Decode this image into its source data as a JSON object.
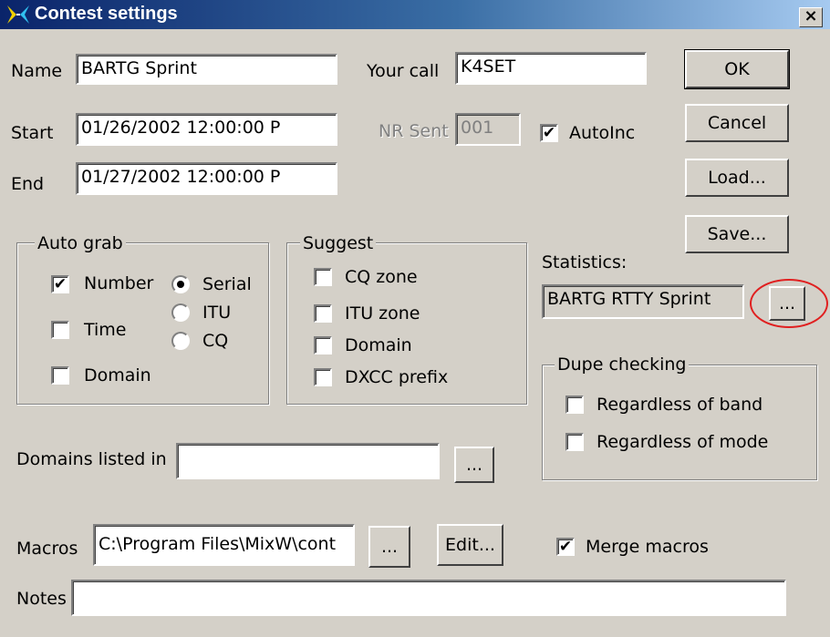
{
  "window": {
    "title": "Contest settings",
    "close_glyph": "×"
  },
  "fields": {
    "name_label": "Name",
    "name_value": "BARTG Sprint",
    "yourcall_label": "Your call",
    "yourcall_value": "K4SET",
    "start_label": "Start",
    "start_value": "01/26/2002 12:00:00 P",
    "nrsent_label": "NR Sent",
    "nrsent_value": "001",
    "end_label": "End",
    "end_value": "01/27/2002 12:00:00 P",
    "autoinc_label": "AutoInc",
    "autoinc_checked": true
  },
  "buttons": {
    "ok": "OK",
    "cancel": "Cancel",
    "load": "Load...",
    "save": "Save...",
    "stats_browse": "...",
    "domains_browse": "...",
    "macros_browse": "...",
    "edit": "Edit..."
  },
  "autograb": {
    "title": "Auto grab",
    "number": "Number",
    "number_checked": true,
    "time": "Time",
    "time_checked": false,
    "domain": "Domain",
    "domain_checked": false,
    "serial": "Serial",
    "itu": "ITU",
    "cq": "CQ",
    "selected": "Serial"
  },
  "suggest": {
    "title": "Suggest",
    "cq_zone": "CQ zone",
    "itu_zone": "ITU zone",
    "domain": "Domain",
    "dxcc": "DXCC prefix"
  },
  "statistics": {
    "label": "Statistics:",
    "value": "BARTG RTTY Sprint"
  },
  "dupe": {
    "title": "Dupe checking",
    "band": "Regardless of band",
    "mode": "Regardless of mode"
  },
  "domains": {
    "label": "Domains listed in",
    "value": ""
  },
  "macros": {
    "label": "Macros",
    "value": "C:\\Program Files\\MixW\\cont",
    "merge_label": "Merge macros",
    "merge_checked": true
  },
  "notes": {
    "label": "Notes",
    "value": ""
  },
  "colors": {
    "face": "#d4d0c8",
    "title_start": "#0a246a",
    "title_end": "#a6caf0",
    "highlight": "#e02020"
  }
}
